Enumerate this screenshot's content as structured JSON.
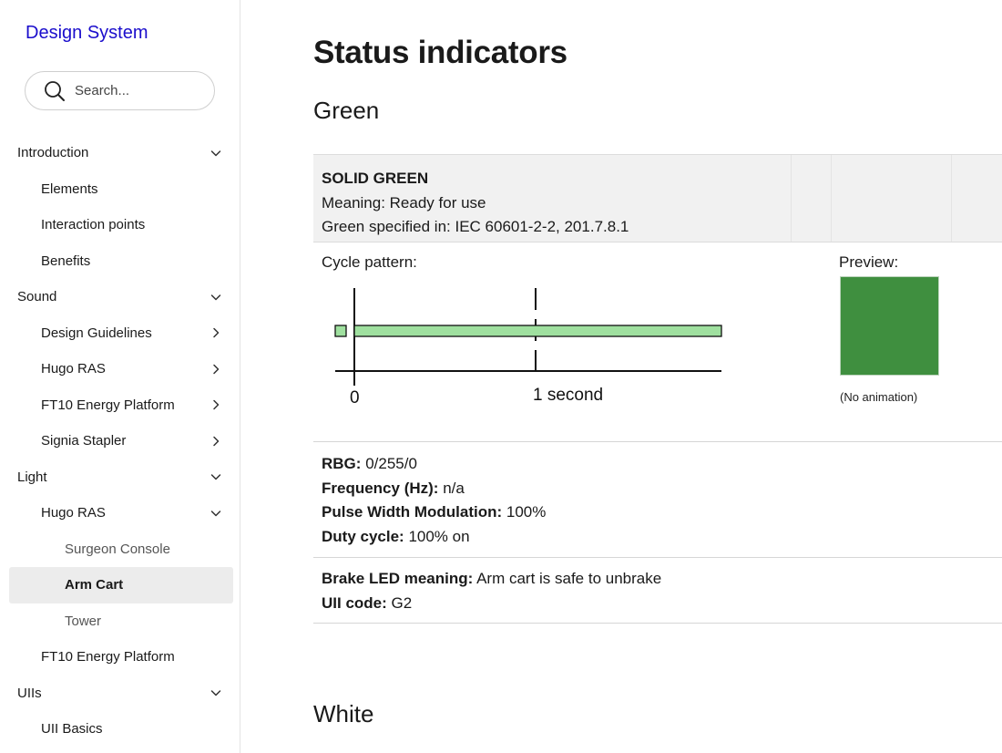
{
  "sidebar": {
    "brand": "Design System",
    "search": {
      "placeholder": "Search..."
    },
    "items": [
      {
        "label": "Introduction",
        "level": 0,
        "chevron": "down"
      },
      {
        "label": "Elements",
        "level": 1,
        "chevron": ""
      },
      {
        "label": "Interaction points",
        "level": 1,
        "chevron": ""
      },
      {
        "label": "Benefits",
        "level": 1,
        "chevron": ""
      },
      {
        "label": "Sound",
        "level": 0,
        "chevron": "down"
      },
      {
        "label": "Design Guidelines",
        "level": 1,
        "chevron": "right"
      },
      {
        "label": "Hugo RAS",
        "level": 1,
        "chevron": "right"
      },
      {
        "label": "FT10 Energy Platform",
        "level": 1,
        "chevron": "right"
      },
      {
        "label": "Signia Stapler",
        "level": 1,
        "chevron": "right"
      },
      {
        "label": "Light",
        "level": 0,
        "chevron": "down"
      },
      {
        "label": "Hugo RAS",
        "level": 1,
        "chevron": "down"
      },
      {
        "label": "Surgeon Console",
        "level": 2,
        "chevron": ""
      },
      {
        "label": "Arm Cart",
        "level": 2,
        "chevron": "",
        "active": true
      },
      {
        "label": "Tower",
        "level": 2,
        "chevron": ""
      },
      {
        "label": "FT10 Energy Platform",
        "level": 1,
        "chevron": ""
      },
      {
        "label": "UIIs",
        "level": 0,
        "chevron": "down"
      },
      {
        "label": "UII Basics",
        "level": 1,
        "chevron": ""
      }
    ]
  },
  "main": {
    "title": "Status indicators",
    "green_section": {
      "title": "Green",
      "header": {
        "name": "SOLID GREEN",
        "meaning": "Meaning: Ready for use",
        "spec": "Green specified in: IEC 60601-2-2, 201.7.8.1"
      },
      "cycle": {
        "label": "Cycle pattern:",
        "tick_zero": "0",
        "tick_one": "1 second",
        "on_fraction": 1.0
      },
      "preview": {
        "label": "Preview:",
        "note": "(No animation)"
      },
      "props": {
        "rgb_label": "RBG:",
        "rgb_value": "0/255/0",
        "freq_label": "Frequency (Hz):",
        "freq_value": "n/a",
        "pwm_label": "Pulse Width Modulation:",
        "pwm_value": "100%",
        "duty_label": "Duty cycle:",
        "duty_value": "100% on"
      },
      "brake": {
        "meaning_label": "Brake LED meaning:",
        "meaning_value": "Arm cart is safe to unbrake",
        "code_label": "UII code:",
        "code_value": "G2"
      }
    },
    "white_section": {
      "title": "White"
    }
  },
  "colors": {
    "brand": "#1a0dcc",
    "preview_green": "#3f8f3f",
    "bar_green": "#9fe09f",
    "active_bg": "#ececec",
    "header_bg": "#f1f1f1"
  },
  "icons": {
    "search": "search-icon",
    "chevron_down": "chevron-down-icon",
    "chevron_right": "chevron-right-icon"
  }
}
